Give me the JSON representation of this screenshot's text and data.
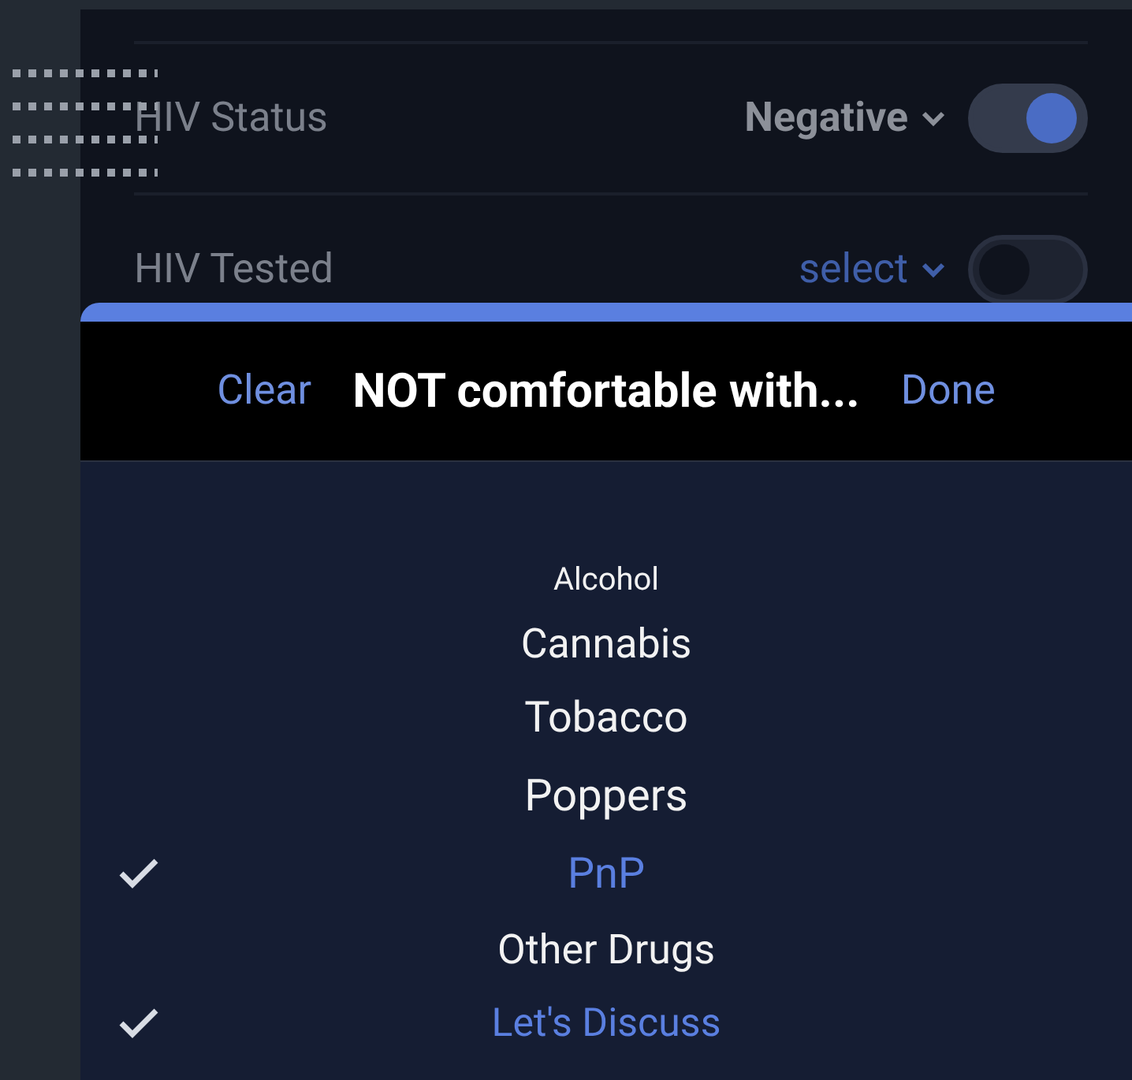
{
  "settings": [
    {
      "label": "HIV Status",
      "value": "Negative",
      "on": true
    },
    {
      "label": "HIV Tested",
      "placeholder": "select",
      "on": false
    }
  ],
  "picker": {
    "clear": "Clear",
    "title": "NOT comfortable with...",
    "done": "Done",
    "options": [
      {
        "label": "Alcohol",
        "selected": false
      },
      {
        "label": "Cannabis",
        "selected": false
      },
      {
        "label": "Tobacco",
        "selected": false
      },
      {
        "label": "Poppers",
        "selected": false
      },
      {
        "label": "PnP",
        "selected": true
      },
      {
        "label": "Other Drugs",
        "selected": false
      },
      {
        "label": "Let's Discuss",
        "selected": true
      }
    ]
  }
}
